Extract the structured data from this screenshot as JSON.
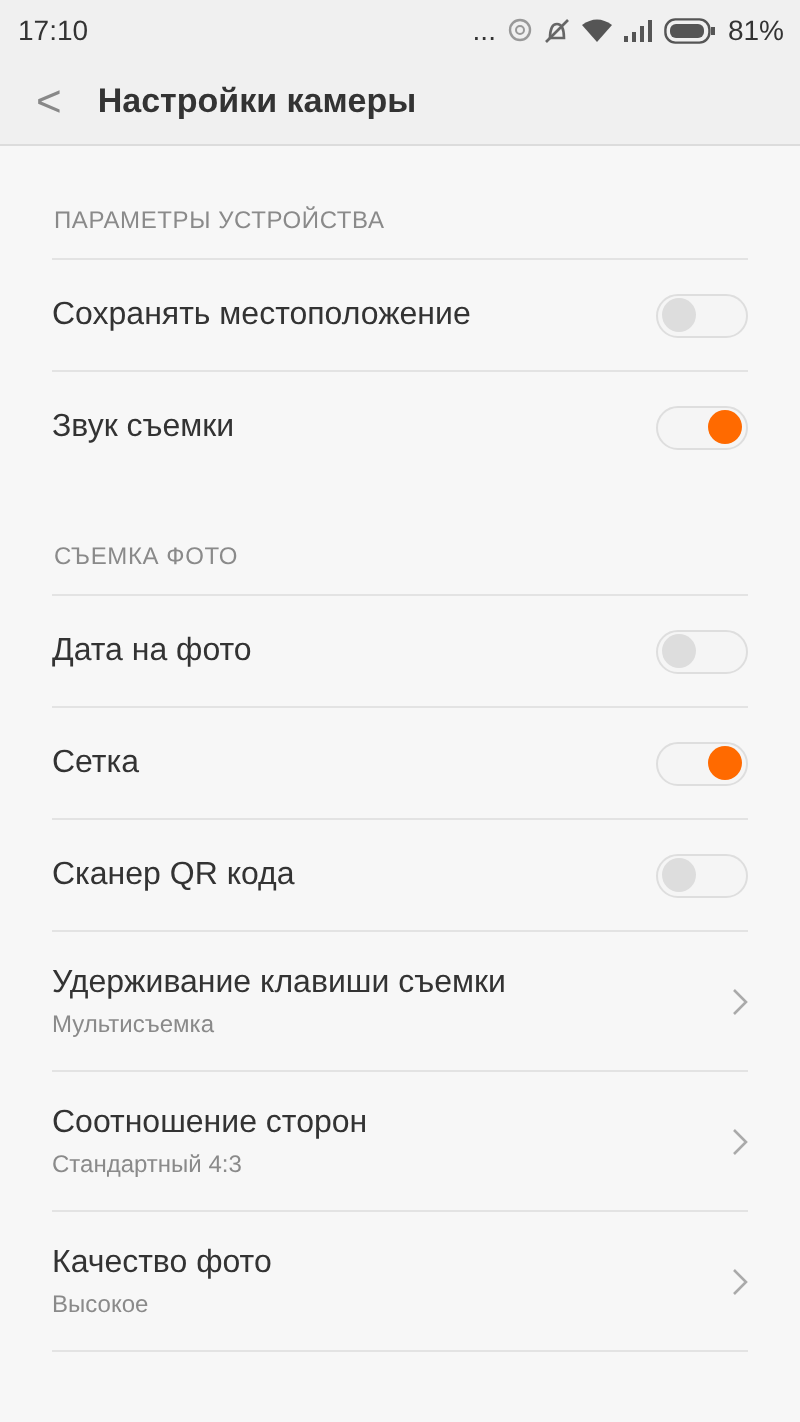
{
  "status_bar": {
    "time": "17:10",
    "overflow": "...",
    "battery_level_text": "81%"
  },
  "header": {
    "back": "<",
    "title": "Настройки камеры"
  },
  "sections": [
    {
      "title": "ПАРАМЕТРЫ УСТРОЙСТВА",
      "items": [
        {
          "kind": "toggle",
          "label": "Сохранять местоположение",
          "on": false
        },
        {
          "kind": "toggle",
          "label": "Звук съемки",
          "on": true
        }
      ]
    },
    {
      "title": "СЪЕМКА ФОТО",
      "items": [
        {
          "kind": "toggle",
          "label": "Дата на фото",
          "on": false
        },
        {
          "kind": "toggle",
          "label": "Сетка",
          "on": true
        },
        {
          "kind": "toggle",
          "label": "Сканер QR кода",
          "on": false
        },
        {
          "kind": "link",
          "label": "Удерживание клавиши съемки",
          "value": "Мультисъемка"
        },
        {
          "kind": "link",
          "label": "Соотношение сторон",
          "value": "Стандартный 4:3"
        },
        {
          "kind": "link",
          "label": "Качество фото",
          "value": "Высокое"
        }
      ]
    }
  ]
}
